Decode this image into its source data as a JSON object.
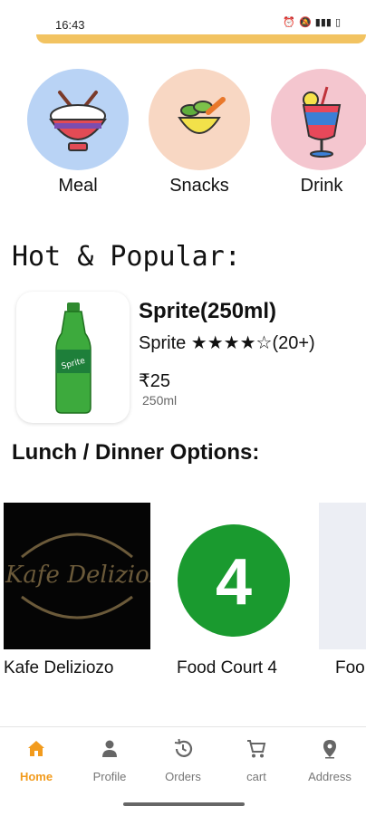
{
  "status": {
    "time": "16:43",
    "icons": [
      "alarm-icon",
      "mute-icon",
      "signal-icon",
      "battery-icon"
    ]
  },
  "categories": [
    {
      "label": "Meal",
      "bg": "#b9d3f5"
    },
    {
      "label": "Snacks",
      "bg": "#f8d7c3"
    },
    {
      "label": "Drink",
      "bg": "#f4c6cf"
    }
  ],
  "hot": {
    "title": "Hot & Popular:",
    "product": {
      "name": "Sprite(250ml)",
      "subtitle": "Sprite ★★★★☆(20+)",
      "price": "₹25",
      "quantity": "250ml",
      "rating": 4,
      "rating_max": 5
    }
  },
  "lunch": {
    "title": "Lunch / Dinner Options:",
    "venues": [
      {
        "label": "Kafe Deliziozo",
        "logo_text": "Kafe Delizioz"
      },
      {
        "label": "Food Court 4",
        "logo_text": "4"
      },
      {
        "label": "Foo"
      }
    ]
  },
  "nav": [
    {
      "label": "Home",
      "icon": "home-icon",
      "active": true
    },
    {
      "label": "Profile",
      "icon": "person-icon",
      "active": false
    },
    {
      "label": "Orders",
      "icon": "history-icon",
      "active": false
    },
    {
      "label": "cart",
      "icon": "cart-icon",
      "active": false
    },
    {
      "label": "Address",
      "icon": "location-pin-icon",
      "active": false
    }
  ],
  "colors": {
    "accent": "#f29b1d",
    "food_court_green": "#1a9a2f",
    "strip": "#f0b945"
  }
}
